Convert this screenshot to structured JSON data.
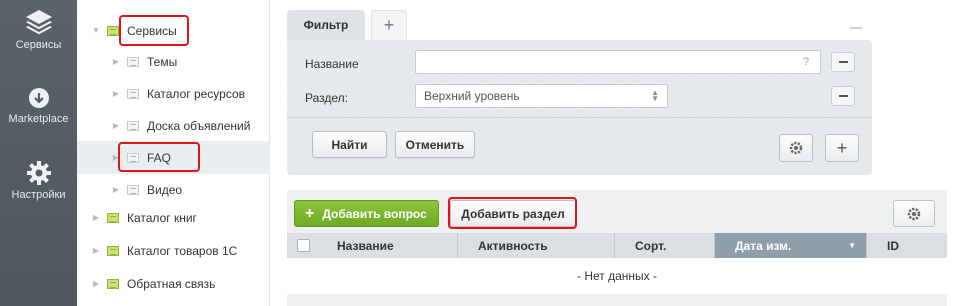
{
  "leftbar": {
    "items": [
      {
        "label": "Сервисы",
        "icon": "layers-icon"
      },
      {
        "label": "Marketplace",
        "icon": "cloud-download-icon"
      },
      {
        "label": "Настройки",
        "icon": "gear-icon"
      }
    ]
  },
  "tree": {
    "items": [
      {
        "label": "Сервисы",
        "level": 0,
        "expanded": true,
        "folder": "green"
      },
      {
        "label": "Темы",
        "level": 1,
        "folder": "grey"
      },
      {
        "label": "Каталог ресурсов",
        "level": 1,
        "folder": "grey"
      },
      {
        "label": "Доска объявлений",
        "level": 1,
        "folder": "grey"
      },
      {
        "label": "FAQ",
        "level": 1,
        "folder": "grey",
        "active": true
      },
      {
        "label": "Видео",
        "level": 1,
        "folder": "grey"
      },
      {
        "label": "Каталог книг",
        "level": 0,
        "folder": "green"
      },
      {
        "label": "Каталог товаров 1С",
        "level": 0,
        "folder": "green"
      },
      {
        "label": "Обратная связь",
        "level": 0,
        "folder": "green"
      }
    ]
  },
  "filter": {
    "tab_label": "Фильтр",
    "add_tab": "+",
    "fields": {
      "name_label": "Название",
      "name_value": "",
      "help": "?",
      "section_label": "Раздел:",
      "section_value": "Верхний уровень"
    },
    "find_label": "Найти",
    "cancel_label": "Отменить",
    "add_label": "+"
  },
  "list": {
    "add_question_label": "Добавить вопрос",
    "add_section_label": "Добавить раздел",
    "columns": [
      "Название",
      "Активность",
      "Сорт.",
      "Дата изм.",
      "ID"
    ],
    "sorted_column": "Дата изм.",
    "empty_text": "- Нет данных -"
  },
  "colors": {
    "highlight": "#e0151b",
    "accent_green": "#7ab92c",
    "sidebar": "#545d64"
  }
}
